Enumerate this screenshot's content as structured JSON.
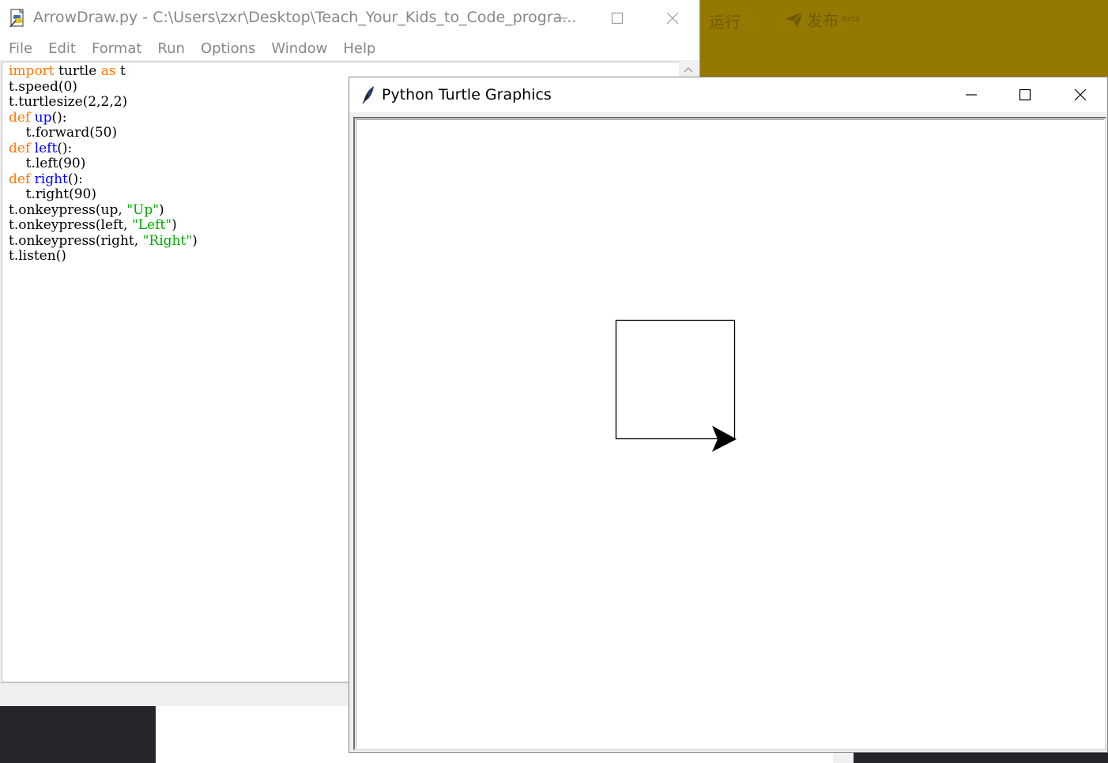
{
  "background": {
    "run_label": "运行",
    "publish_label": "发布",
    "publish_badge": "Beta",
    "accent_color": "#957800"
  },
  "idle": {
    "title": "ArrowDraw.py - C:\\Users\\zxr\\Desktop\\Teach_Your_Kids_to_Code_progra...",
    "menu": [
      "File",
      "Edit",
      "Format",
      "Run",
      "Options",
      "Window",
      "Help"
    ],
    "code_lines": [
      [
        {
          "t": "import",
          "c": "kw"
        },
        {
          "t": " turtle "
        },
        {
          "t": "as",
          "c": "kw"
        },
        {
          "t": " t"
        }
      ],
      [
        {
          "t": "t.speed(0)"
        }
      ],
      [
        {
          "t": "t.turtlesize(2,2,2)"
        }
      ],
      [
        {
          "t": "def",
          "c": "kw"
        },
        {
          "t": " "
        },
        {
          "t": "up",
          "c": "fn"
        },
        {
          "t": "():"
        }
      ],
      [
        {
          "t": "    t.forward(50)"
        }
      ],
      [
        {
          "t": "def",
          "c": "kw"
        },
        {
          "t": " "
        },
        {
          "t": "left",
          "c": "fn"
        },
        {
          "t": "():"
        }
      ],
      [
        {
          "t": "    t.left(90)"
        }
      ],
      [
        {
          "t": "def",
          "c": "kw"
        },
        {
          "t": " "
        },
        {
          "t": "right",
          "c": "fn"
        },
        {
          "t": "():"
        }
      ],
      [
        {
          "t": "    t.right(90)"
        }
      ],
      [
        {
          "t": "t.onkeypress(up, "
        },
        {
          "t": "\"Up\"",
          "c": "str"
        },
        {
          "t": ")"
        }
      ],
      [
        {
          "t": "t.onkeypress(left, "
        },
        {
          "t": "\"Left\"",
          "c": "str"
        },
        {
          "t": ")"
        }
      ],
      [
        {
          "t": "t.onkeypress(right, "
        },
        {
          "t": "\"Right\"",
          "c": "str"
        },
        {
          "t": ")"
        }
      ],
      [
        {
          "t": "t.listen()"
        }
      ]
    ],
    "syntax_colors": {
      "keyword": "#ff7700",
      "builtin": "#0000ff",
      "string": "#00aa00"
    }
  },
  "turtle": {
    "title": "Python Turtle Graphics"
  }
}
